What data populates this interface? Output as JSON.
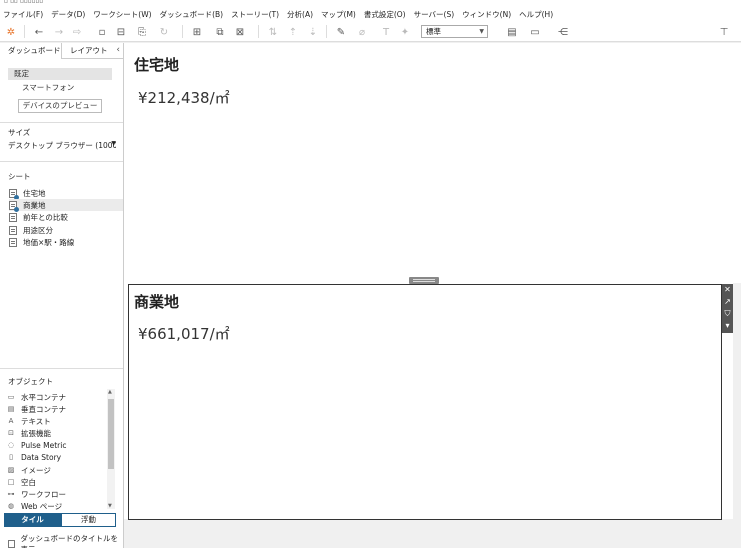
{
  "menu": [
    "ファイル(F)",
    "データ(D)",
    "ワークシート(W)",
    "ダッシュボード(B)",
    "ストーリー(T)",
    "分析(A)",
    "マップ(M)",
    "書式設定(O)",
    "サーバー(S)",
    "ウィンドウ(N)",
    "ヘルプ(H)"
  ],
  "toolbar": {
    "view_select": "標準"
  },
  "sidebar": {
    "tab_dashboard": "ダッシュボード",
    "tab_layout": "レイアウト",
    "device_default": "既定",
    "device_phone": "スマートフォン",
    "device_preview": "デバイスのプレビュー",
    "size_title": "サイズ",
    "size_value": "デスクトップ ブラウザー (1000 ⋯",
    "sheets_title": "シート",
    "sheets": [
      "住宅地",
      "商業地",
      "前年との比較",
      "用途区分",
      "地価×駅・路線"
    ],
    "objects_title": "オブジェクト",
    "objects": [
      "水平コンテナ",
      "垂直コンテナ",
      "テキスト",
      "拡張機能",
      "Pulse Metric",
      "Data Story",
      "イメージ",
      "空白",
      "ワークフロー",
      "Web ページ"
    ],
    "mode_tiled": "タイル",
    "mode_floating": "浮動",
    "show_title": "ダッシュボードのタイトルを表示"
  },
  "dashboard": {
    "residential_title": "住宅地",
    "residential_value": "¥212,438/㎡",
    "commercial_title": "商業地",
    "commercial_value": "¥661,017/㎡"
  }
}
